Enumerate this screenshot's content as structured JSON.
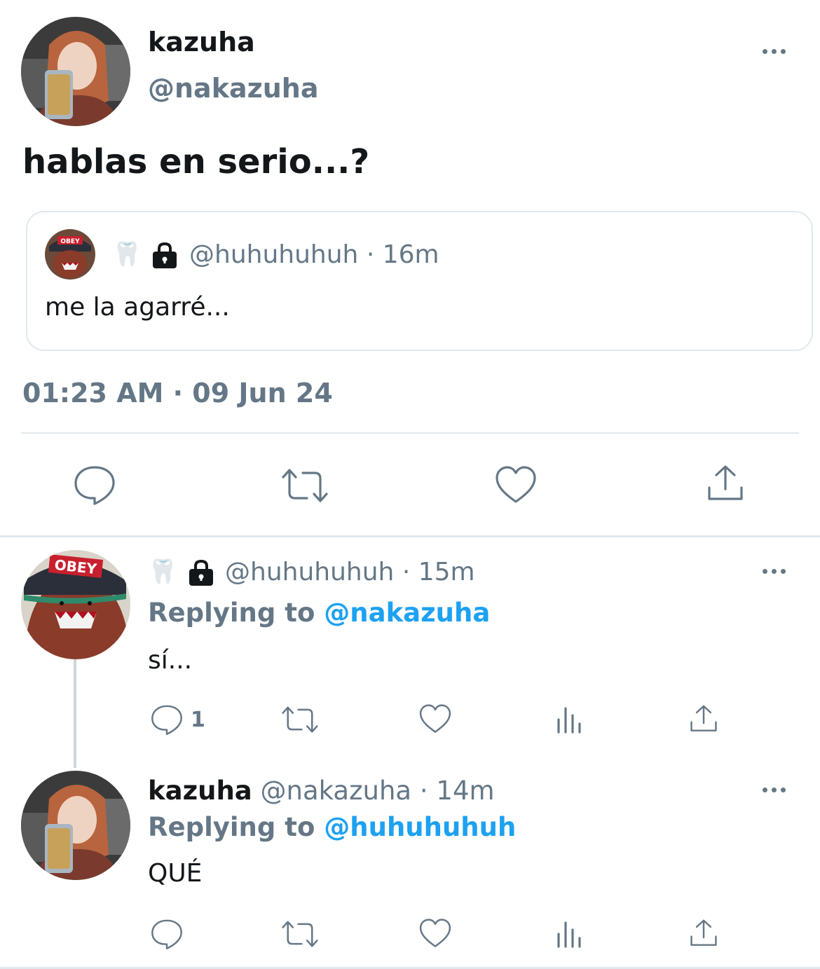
{
  "main_tweet": {
    "name": "kazuha",
    "handle": "@nakazuha",
    "text": "hablas en serio...?",
    "timestamp": "01:23 AM · 09 Jun 24",
    "quoted": {
      "emoji": "🦷",
      "handle": "@huhuhuhuh",
      "separator": "·",
      "time": "16m",
      "text": "me la agarré..."
    }
  },
  "replies": [
    {
      "name": "",
      "emoji": "🦷",
      "handle": "@huhuhuhuh",
      "separator": "·",
      "time": "15m",
      "replying_label": "Replying to",
      "replying_to": "@nakazuha",
      "text": "sí...",
      "reply_count": "1"
    },
    {
      "name": "kazuha",
      "handle": "@nakazuha",
      "separator": "·",
      "time": "14m",
      "replying_label": "Replying to",
      "replying_to": "@huhuhuhuh",
      "text": "QUÉ",
      "reply_count": ""
    }
  ],
  "colors": {
    "accent": "#1da1f2",
    "muted": "#657786",
    "text": "#14171a",
    "border": "#e1e8ed"
  },
  "icons": [
    "more-icon",
    "reply-icon",
    "retweet-icon",
    "like-icon",
    "share-icon",
    "views-icon",
    "lock-icon",
    "tooth-emoji"
  ]
}
